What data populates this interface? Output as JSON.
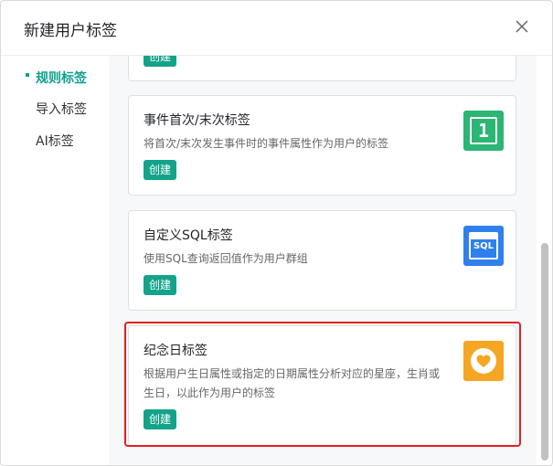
{
  "dialog": {
    "title": "新建用户标签",
    "close_icon": "close-icon"
  },
  "sidebar": {
    "items": [
      {
        "label": "规则标签",
        "active": true
      },
      {
        "label": "导入标签",
        "active": false
      },
      {
        "label": "AI标签",
        "active": false
      }
    ]
  },
  "cards": [
    {
      "title": "",
      "desc": "",
      "create_label": "创建"
    },
    {
      "title": "事件首次/末次标签",
      "desc": "将首次/末次发生事件时的事件属性作为用户的标签",
      "create_label": "创建",
      "icon": "number-one-icon",
      "icon_text": "1",
      "icon_color": "#2bb673"
    },
    {
      "title": "自定义SQL标签",
      "desc": "使用SQL查询返回值作为用户群组",
      "create_label": "创建",
      "icon": "sql-icon",
      "icon_text": "SQL",
      "icon_color": "#2f80ed"
    },
    {
      "title": "纪念日标签",
      "desc": "根据用户生日属性或指定的日期属性分析对应的星座，生肖或生日，以此作为用户的标签",
      "create_label": "创建",
      "icon": "heart-icon",
      "icon_color": "#f5a623"
    }
  ],
  "colors": {
    "accent": "#13a38a",
    "highlight": "#e02020"
  }
}
